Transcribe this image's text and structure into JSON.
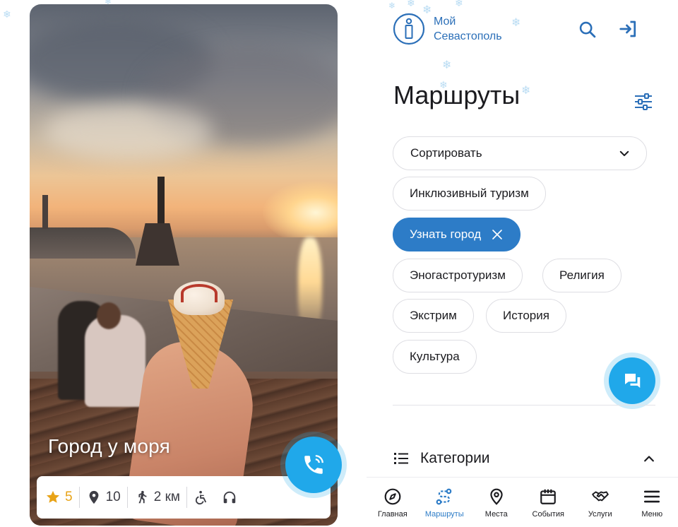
{
  "route_card": {
    "title": "Город у моря",
    "rating": "5",
    "places": "10",
    "distance": "2 км",
    "features": [
      "wheelchair-icon",
      "headphones-icon"
    ],
    "accent_star": "#e8a317"
  },
  "header": {
    "logo_line1": "Мой",
    "logo_line2": "Севастополь",
    "logo_icon": "info-i-icon",
    "search_icon": "search-icon",
    "login_icon": "login-arrow-icon"
  },
  "page": {
    "title": "Маршруты",
    "filter_icon": "sliders-icon"
  },
  "sort": {
    "label": "Сортировать",
    "icon": "chevron-down-icon"
  },
  "chips": [
    {
      "label": "Инклюзивный туризм",
      "active": false
    },
    {
      "label": "Узнать город",
      "active": true
    },
    {
      "label": "Эногастротуризм",
      "active": false
    },
    {
      "label": "Религия",
      "active": false
    },
    {
      "label": "Экстрим",
      "active": false
    },
    {
      "label": "История",
      "active": false
    },
    {
      "label": "Культура",
      "active": false
    }
  ],
  "categories": {
    "label": "Категории",
    "icon": "list-icon",
    "toggle_icon": "chevron-up-icon"
  },
  "bottom_nav": [
    {
      "label": "Главная",
      "icon": "compass-icon",
      "active": false
    },
    {
      "label": "Маршруты",
      "icon": "route-icon",
      "active": true
    },
    {
      "label": "Места",
      "icon": "map-pin-icon",
      "active": false
    },
    {
      "label": "События",
      "icon": "calendar-icon",
      "active": false
    },
    {
      "label": "Услуги",
      "icon": "handshake-icon",
      "active": false
    },
    {
      "label": "Меню",
      "icon": "menu-icon",
      "active": false
    }
  ],
  "colors": {
    "accent": "#2d7cc7",
    "fab": "#20a8ea",
    "logo": "#2b6fb8"
  }
}
